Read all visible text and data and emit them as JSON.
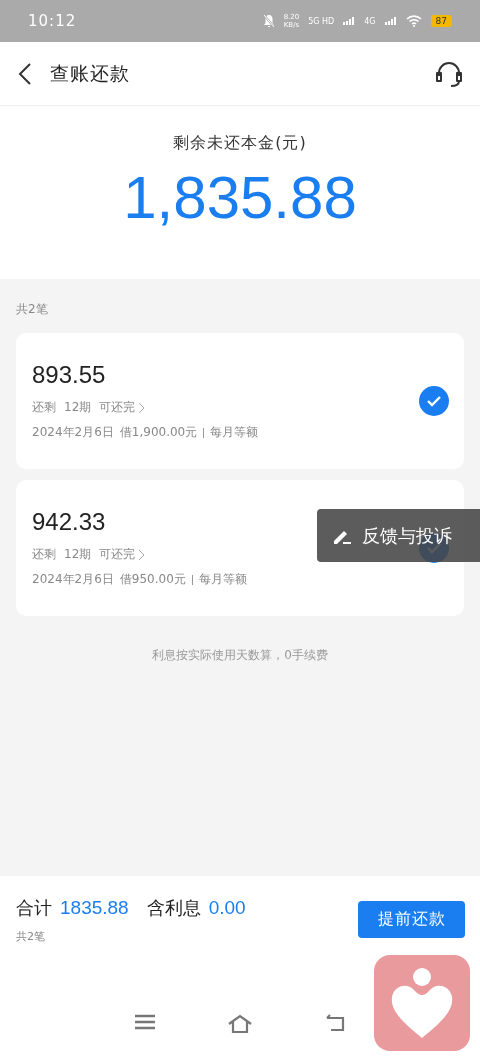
{
  "status_bar": {
    "time": "10:12",
    "speed": "8.20",
    "speed_unit": "KB/s",
    "network_1": "5G HD",
    "network_2": "4G",
    "battery": "87"
  },
  "header": {
    "title": "查账还款"
  },
  "summary": {
    "label": "剩余未还本金(元)",
    "amount": "1,835.88"
  },
  "list": {
    "count": "共2笔",
    "items": [
      {
        "amount": "893.55",
        "remaining_label": "还剩",
        "periods": "12期",
        "action": "可还完",
        "date": "2024年2月6日",
        "loan": "借1,900.00元",
        "method": "每月等额",
        "selected": true
      },
      {
        "amount": "942.33",
        "remaining_label": "还剩",
        "periods": "12期",
        "action": "可还完",
        "date": "2024年2月6日",
        "loan": "借950.00元",
        "method": "每月等额",
        "selected": true
      }
    ],
    "note": "利息按实际使用天数算，0手续费"
  },
  "feedback": {
    "label": "反馈与投诉"
  },
  "footer": {
    "total_label": "合计",
    "total": "1835.88",
    "interest_label": "含利息",
    "interest": "0.00",
    "count": "共2笔",
    "button": "提前还款"
  }
}
